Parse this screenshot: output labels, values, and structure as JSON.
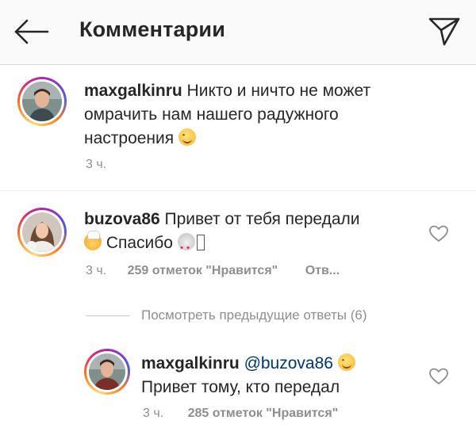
{
  "header": {
    "title": "Комментарии"
  },
  "comments": [
    {
      "username": "maxgalkinru",
      "text_line1": " Никто и ничто не может",
      "text_line2": "омрачить нам нашего радужного",
      "text_line3": "настроения",
      "time": "3 ч."
    },
    {
      "username": "buzova86",
      "text_line1": " Привет от тебя передали",
      "text_line2": " Спасибо",
      "time": "3 ч.",
      "likes": "259 отметок \"Нравится\"",
      "reply": "Отв..."
    }
  ],
  "view_replies": "Посмотреть предыдущие ответы (6)",
  "reply": {
    "username": "maxgalkinru",
    "mention": "@buzova86",
    "text_line2": "Привет тому, кто передал",
    "time": "3 ч.",
    "likes": "285 отметок \"Нравится\""
  },
  "icons": {
    "back": "arrow-left-icon",
    "send": "paper-plane-icon",
    "like": "heart-outline-icon"
  }
}
